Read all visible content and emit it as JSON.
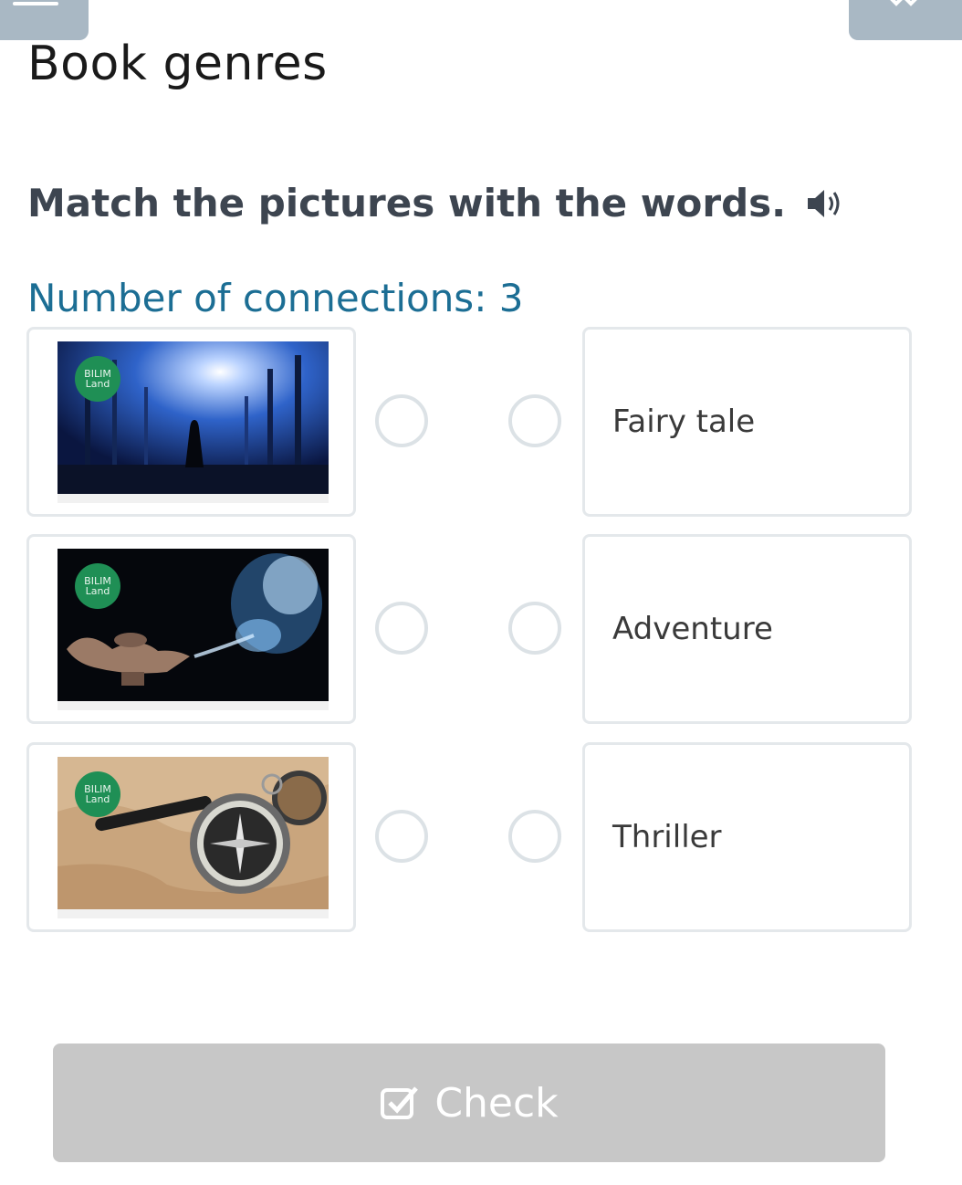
{
  "page": {
    "title": "Book genres",
    "instruction": "Match the pictures with the words.",
    "connections_label": "Number of connections: 3"
  },
  "pictures": [
    {
      "badge_line1": "BILIM",
      "badge_line2": "Land",
      "icon": "forest-night-picture"
    },
    {
      "badge_line1": "BILIM",
      "badge_line2": "Land",
      "icon": "magic-lamp-picture"
    },
    {
      "badge_line1": "BILIM",
      "badge_line2": "Land",
      "icon": "compass-map-picture"
    }
  ],
  "words": [
    {
      "label": "Fairy tale"
    },
    {
      "label": "Adventure"
    },
    {
      "label": "Thriller"
    }
  ],
  "check_button": {
    "label": "Check",
    "icon": "checkbox-icon"
  },
  "colors": {
    "connections_text": "#1c6e94",
    "badge": "#1f8f55",
    "button_disabled": "#c7c7c7",
    "card_border": "#e4e8eb"
  }
}
